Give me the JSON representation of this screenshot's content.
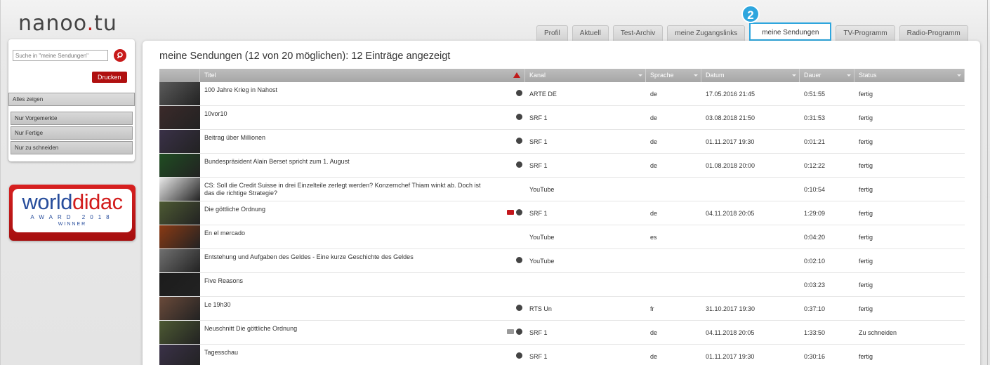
{
  "logo": {
    "pre": "nanoo",
    "dot": ".",
    "post": "tu"
  },
  "tabs": [
    "Profil",
    "Aktuell",
    "Test-Archiv",
    "meine Zugangslinks",
    "meine Sendungen",
    "TV-Programm",
    "Radio-Programm"
  ],
  "active_tab_index": 4,
  "badge": "2",
  "sidebar": {
    "search_placeholder": "Suche in \"meine Sendungen\"",
    "print_label": "Drucken",
    "filters": [
      "Alles zeigen",
      "Nur Vorgemerkte",
      "Nur Fertige",
      "Nur zu schneiden"
    ]
  },
  "award": {
    "word1": "world",
    "word2": "didac",
    "sub": "AWARD 2018",
    "win": "WINNER"
  },
  "main": {
    "title": "meine Sendungen (12 von 20 möglichen): 12 Einträge angezeigt",
    "columns": [
      "Titel",
      "Kanal",
      "Sprache",
      "Datum",
      "Dauer",
      "Status"
    ],
    "rows": [
      {
        "title": "100 Jahre Krieg in Nahost",
        "kanal": "ARTE DE",
        "lang": "de",
        "date": "17.05.2016 21:45",
        "dur": "0:51:55",
        "status": "fertig",
        "icons": [
          "info"
        ],
        "thumb": "#5a5a5a"
      },
      {
        "title": "10vor10",
        "kanal": "SRF 1",
        "lang": "de",
        "date": "03.08.2018 21:50",
        "dur": "0:31:53",
        "status": "fertig",
        "icons": [
          "info"
        ],
        "thumb": "#3b2a2a"
      },
      {
        "title": "Beitrag über Millionen",
        "kanal": "SRF 1",
        "lang": "de",
        "date": "01.11.2017 19:30",
        "dur": "0:01:21",
        "status": "fertig",
        "icons": [
          "info"
        ],
        "thumb": "#3a3148"
      },
      {
        "title": "Bundespräsident Alain Berset spricht zum 1. August",
        "kanal": "SRF 1",
        "lang": "de",
        "date": "01.08.2018 20:00",
        "dur": "0:12:22",
        "status": "fertig",
        "icons": [
          "info"
        ],
        "thumb": "#1f4d22"
      },
      {
        "title": "CS: Soll die Credit Suisse in drei Einzelteile zerlegt werden? Konzernchef Thiam winkt ab. Doch ist das die richtige Strategie?",
        "kanal": "YouTube",
        "lang": "",
        "date": "",
        "dur": "0:10:54",
        "status": "fertig",
        "icons": [],
        "thumb": "#e9e9e9"
      },
      {
        "title": "Die göttliche Ordnung",
        "kanal": "SRF 1",
        "lang": "de",
        "date": "04.11.2018 20:05",
        "dur": "1:29:09",
        "status": "fertig",
        "icons": [
          "folder-red",
          "info"
        ],
        "thumb": "#4d5a33"
      },
      {
        "title": "En el mercado",
        "kanal": "YouTube",
        "lang": "es",
        "date": "",
        "dur": "0:04:20",
        "status": "fertig",
        "icons": [],
        "thumb": "#8a3a14"
      },
      {
        "title": "Entstehung und Aufgaben des Geldes - Eine kurze Geschichte des Geldes",
        "kanal": "YouTube",
        "lang": "",
        "date": "",
        "dur": "0:02:10",
        "status": "fertig",
        "icons": [
          "info"
        ],
        "thumb": "#707070"
      },
      {
        "title": "Five Reasons",
        "kanal": "",
        "lang": "",
        "date": "",
        "dur": "0:03:23",
        "status": "fertig",
        "icons": [],
        "thumb": "#1c1c1c"
      },
      {
        "title": "Le 19h30",
        "kanal": "RTS Un",
        "lang": "fr",
        "date": "31.10.2017 19:30",
        "dur": "0:37:10",
        "status": "fertig",
        "icons": [
          "info"
        ],
        "thumb": "#6a4a3a"
      },
      {
        "title": "Neuschnitt Die göttliche Ordnung",
        "kanal": "SRF 1",
        "lang": "de",
        "date": "04.11.2018 20:05",
        "dur": "1:33:50",
        "status": "Zu schneiden",
        "icons": [
          "folder-grey",
          "info"
        ],
        "thumb": "#4d5a33"
      },
      {
        "title": "Tagesschau",
        "kanal": "SRF 1",
        "lang": "de",
        "date": "01.11.2017 19:30",
        "dur": "0:30:16",
        "status": "fertig",
        "icons": [
          "info"
        ],
        "thumb": "#3a3148"
      }
    ]
  },
  "colors": {
    "accent_red": "#c21b1b",
    "highlight_blue": "#2ea6de",
    "header_grey": "#a6a6a6"
  }
}
